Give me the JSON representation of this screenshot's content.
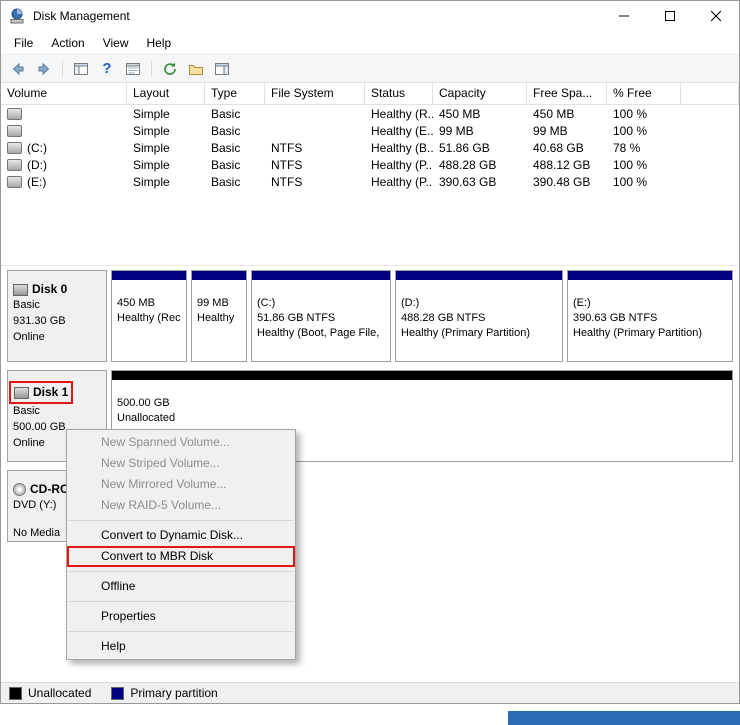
{
  "window": {
    "title": "Disk Management"
  },
  "menubar": {
    "items": [
      "File",
      "Action",
      "View",
      "Help"
    ]
  },
  "toolbar": {
    "icons": [
      "back",
      "forward",
      "console-tree",
      "help",
      "properties",
      "refresh",
      "export-list",
      "action-pane"
    ]
  },
  "volume_table": {
    "columns": [
      "Volume",
      "Layout",
      "Type",
      "File System",
      "Status",
      "Capacity",
      "Free Spa...",
      "% Free"
    ],
    "rows": [
      {
        "volume": "",
        "layout": "Simple",
        "type": "Basic",
        "file_system": "",
        "status": "Healthy (R...",
        "capacity": "450 MB",
        "free_space": "450 MB",
        "pct_free": "100 %"
      },
      {
        "volume": "",
        "layout": "Simple",
        "type": "Basic",
        "file_system": "",
        "status": "Healthy (E...",
        "capacity": "99 MB",
        "free_space": "99 MB",
        "pct_free": "100 %"
      },
      {
        "volume": "(C:)",
        "layout": "Simple",
        "type": "Basic",
        "file_system": "NTFS",
        "status": "Healthy (B...",
        "capacity": "51.86 GB",
        "free_space": "40.68 GB",
        "pct_free": "78 %"
      },
      {
        "volume": "(D:)",
        "layout": "Simple",
        "type": "Basic",
        "file_system": "NTFS",
        "status": "Healthy (P...",
        "capacity": "488.28 GB",
        "free_space": "488.12 GB",
        "pct_free": "100 %"
      },
      {
        "volume": "(E:)",
        "layout": "Simple",
        "type": "Basic",
        "file_system": "NTFS",
        "status": "Healthy (P...",
        "capacity": "390.63 GB",
        "free_space": "390.48 GB",
        "pct_free": "100 %"
      }
    ]
  },
  "disks": [
    {
      "name": "Disk 0",
      "type": "Basic",
      "size": "931.30 GB",
      "status": "Online",
      "partitions": [
        {
          "title": "",
          "size": "450 MB",
          "status": "Healthy (Rec"
        },
        {
          "title": "",
          "size": "99 MB",
          "status": "Healthy"
        },
        {
          "title": "(C:)",
          "size": "51.86 GB NTFS",
          "status": "Healthy (Boot, Page File,"
        },
        {
          "title": "(D:)",
          "size": "488.28 GB NTFS",
          "status": "Healthy (Primary Partition)"
        },
        {
          "title": "(E:)",
          "size": "390.63 GB NTFS",
          "status": "Healthy (Primary Partition)"
        }
      ]
    },
    {
      "name": "Disk 1",
      "type": "Basic",
      "size": "500.00 GB",
      "status": "Online",
      "partitions": [
        {
          "title": "",
          "size": "500.00 GB",
          "status": "Unallocated"
        }
      ]
    },
    {
      "name": "CD-RO",
      "type": "DVD (Y:)",
      "status": "No Media"
    }
  ],
  "context_menu": {
    "items": [
      {
        "label": "New Spanned Volume...",
        "enabled": false
      },
      {
        "label": "New Striped Volume...",
        "enabled": false
      },
      {
        "label": "New Mirrored Volume...",
        "enabled": false
      },
      {
        "label": "New RAID-5 Volume...",
        "enabled": false
      },
      {
        "label": "Convert to Dynamic Disk...",
        "enabled": true
      },
      {
        "label": "Convert to MBR Disk",
        "enabled": true,
        "annotated": true
      },
      {
        "label": "Offline",
        "enabled": true
      },
      {
        "label": "Properties",
        "enabled": true
      },
      {
        "label": "Help",
        "enabled": true
      }
    ]
  },
  "legend": {
    "items": [
      {
        "label": "Unallocated",
        "color": "#000000"
      },
      {
        "label": "Primary partition",
        "color": "#000080"
      }
    ]
  },
  "colors": {
    "primary_partition": "#000080",
    "unallocated": "#000000",
    "annotation_red": "#e31515",
    "taskbar_blue": "#2a6cb5"
  }
}
